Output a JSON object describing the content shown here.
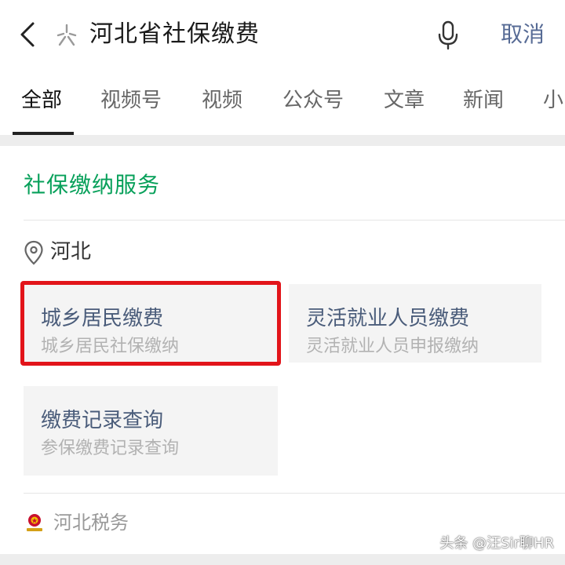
{
  "search": {
    "query": "河北省社保缴费",
    "cancel_label": "取消"
  },
  "tabs": [
    {
      "label": "全部",
      "active": true
    },
    {
      "label": "视频号",
      "active": false
    },
    {
      "label": "视频",
      "active": false
    },
    {
      "label": "公众号",
      "active": false
    },
    {
      "label": "文章",
      "active": false
    },
    {
      "label": "新闻",
      "active": false
    },
    {
      "label": "小",
      "active": false
    }
  ],
  "service_card": {
    "title": "社保缴纳服务",
    "region": "河北",
    "services": [
      {
        "title": "城乡居民缴费",
        "subtitle": "城乡居民社保缴纳",
        "highlighted": true
      },
      {
        "title": "灵活就业人员缴费",
        "subtitle": "灵活就业人员申报缴纳",
        "highlighted": false
      },
      {
        "title": "缴费记录查询",
        "subtitle": "参保缴费记录查询",
        "highlighted": false
      }
    ],
    "source": "河北税务"
  },
  "watermark": "头条 @汪Sir聊HR",
  "colors": {
    "accent_green": "#07a05a",
    "link_blue": "#576b95",
    "highlight_red": "#e2141a"
  },
  "icons": [
    "back-arrow-icon",
    "sparkle-icon",
    "microphone-icon",
    "location-pin-icon",
    "tax-emblem-icon"
  ]
}
